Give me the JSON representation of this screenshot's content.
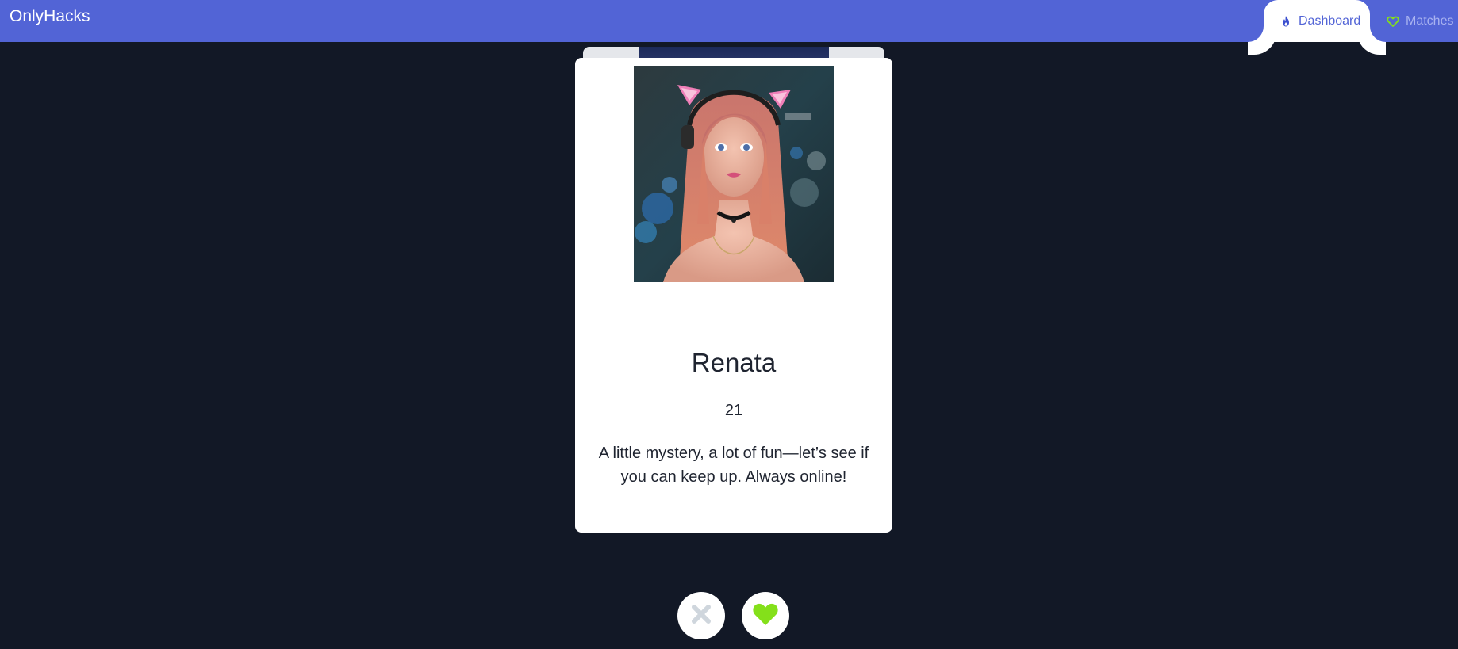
{
  "app": {
    "brand": "OnlyHacks"
  },
  "nav": {
    "tabs": [
      {
        "label": "Dashboard",
        "icon": "flame-icon",
        "active": true
      },
      {
        "label": "Matches",
        "icon": "heart-outline-icon",
        "active": false
      }
    ]
  },
  "profile": {
    "name": "Renata",
    "age": "21",
    "bio": "A little mystery, a lot of fun—let’s see if you can keep up. Always online!"
  },
  "actions": {
    "nope_icon": "x-icon",
    "like_icon": "heart-icon"
  },
  "colors": {
    "header": "#5264d6",
    "background": "#121826",
    "like_accent": "#84e01a",
    "nope_accent": "#cfd6dd"
  }
}
